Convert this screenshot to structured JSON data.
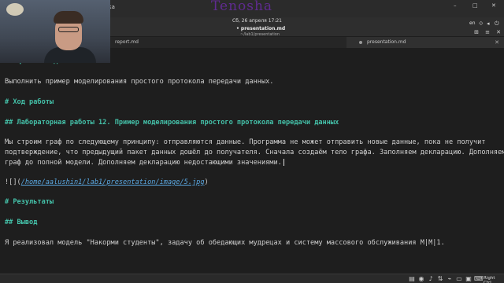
{
  "topbar": {
    "menu_item": "правка",
    "watermark": "Tenosha",
    "clock": "Сб, 26 апреля 17:21",
    "minimize": "–",
    "maximize": "□",
    "close": "✕"
  },
  "header": {
    "language": "en",
    "doc_title": "• presentation.md",
    "doc_path": "~/lab1/presentation",
    "tray_icons": [
      "network-icon",
      "volume-icon",
      "power-icon"
    ]
  },
  "tabs": [
    {
      "label": "report.md"
    },
    {
      "label": "presentation.md",
      "close": "✕"
    }
  ],
  "editor": {
    "lines": [
      {
        "type": "heading",
        "text": "## Цели и задачи"
      },
      {
        "type": "text",
        "text": "Выполнить пример моделирования простого протокола передачи данных."
      },
      {
        "type": "heading",
        "text": "# Ход работы"
      },
      {
        "type": "heading",
        "text": "## Лабораторная работы 12. Пример моделирования простого протокола передачи данных"
      },
      {
        "type": "text",
        "text": "Мы строим граф по следующему принципу: отправляются данные. Программа не может отправить новые данные, пока не получит"
      },
      {
        "type": "text",
        "text": "подтверждение, что предыдущий пакет данных дошёл до получателя. Сначала создаём тело графа. Заполняем декларацию. Дополняем"
      },
      {
        "type": "text",
        "text": "граф до полной модели. Дополняем декларацию недостающими значениями."
      },
      {
        "type": "link",
        "prefix": "![](",
        "url": "/home/aalushin1/lab1/presentation/image/5.jpg",
        "suffix": ")"
      },
      {
        "type": "heading",
        "text": "# Результаты"
      },
      {
        "type": "heading",
        "text": "## Вывод"
      },
      {
        "type": "text",
        "text": "Я реализовал модель \"Накорми студенты\", задачу об обедающих мудрецах и систему массового обслуживания M|M|1."
      }
    ]
  },
  "taskbar": {
    "right_ctrl": "Right Ctrl"
  },
  "colors": {
    "heading": "#44c0a8",
    "link": "#5aa7e0",
    "background": "#1e1e1e",
    "watermark": "#8a2be2"
  }
}
